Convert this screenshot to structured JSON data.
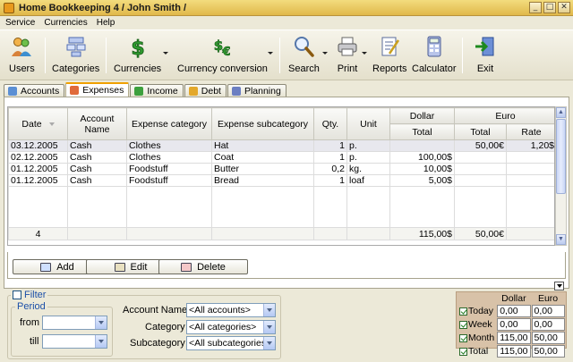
{
  "window": {
    "title": "Home Bookkeeping 4  / John Smith /",
    "controls": {
      "minimize": "_",
      "maximize": "□",
      "close": "✕"
    }
  },
  "menu": [
    "Service",
    "Currencies",
    "Help"
  ],
  "toolbar": {
    "users": "Users",
    "categories": "Categories",
    "currencies": "Currencies",
    "currency_conversion": "Currency conversion",
    "search": "Search",
    "print": "Print",
    "reports": "Reports",
    "calculator": "Calculator",
    "exit": "Exit"
  },
  "tabs": [
    {
      "label": "Accounts",
      "icon": "accounts-icon"
    },
    {
      "label": "Expenses",
      "icon": "expenses-icon",
      "active": true
    },
    {
      "label": "Income",
      "icon": "income-icon"
    },
    {
      "label": "Debt",
      "icon": "debt-icon"
    },
    {
      "label": "Planning",
      "icon": "planning-icon"
    }
  ],
  "grid": {
    "headers": {
      "date": "Date",
      "account": "Account Name",
      "category": "Expense category",
      "subcategory": "Expense subcategory",
      "qty": "Qty.",
      "unit": "Unit",
      "dollar": "Dollar",
      "dollar_total": "Total",
      "euro": "Euro",
      "euro_total": "Total",
      "euro_rate": "Rate"
    },
    "rows": [
      {
        "date": "03.12.2005",
        "account": "Cash",
        "category": "Clothes",
        "subcategory": "Hat",
        "qty": "1",
        "unit": "p.",
        "dollar_total": "",
        "euro_total": "50,00€",
        "euro_rate": "1,20$"
      },
      {
        "date": "02.12.2005",
        "account": "Cash",
        "category": "Clothes",
        "subcategory": "Coat",
        "qty": "1",
        "unit": "p.",
        "dollar_total": "100,00$",
        "euro_total": "",
        "euro_rate": ""
      },
      {
        "date": "01.12.2005",
        "account": "Cash",
        "category": "Foodstuff",
        "subcategory": "Butter",
        "qty": "0,2",
        "unit": "kg.",
        "dollar_total": "10,00$",
        "euro_total": "",
        "euro_rate": ""
      },
      {
        "date": "01.12.2005",
        "account": "Cash",
        "category": "Foodstuff",
        "subcategory": "Bread",
        "qty": "1",
        "unit": "loaf",
        "dollar_total": "5,00$",
        "euro_total": "",
        "euro_rate": ""
      }
    ],
    "footer": {
      "count": "4",
      "dollar_total": "115,00$",
      "euro_total": "50,00€"
    }
  },
  "actions": {
    "add": "Add",
    "edit": "Edit",
    "delete": "Delete"
  },
  "filter": {
    "label": "Filter",
    "period_label": "Period",
    "from_label": "from",
    "till_label": "till",
    "from_value": "",
    "till_value": "",
    "account_label": "Account Name",
    "account_value": "<All accounts>",
    "category_label": "Category",
    "category_value": "<All categories>",
    "subcategory_label": "Subcategory",
    "subcategory_value": "<All subcategories>"
  },
  "summary": {
    "col_dollar": "Dollar",
    "col_euro": "Euro",
    "rows": [
      {
        "label": "Today",
        "dollar": "0,00",
        "euro": "0,00"
      },
      {
        "label": "Week",
        "dollar": "0,00",
        "euro": "0,00"
      },
      {
        "label": "Month",
        "dollar": "115,00",
        "euro": "50,00"
      },
      {
        "label": "Total",
        "dollar": "115,00",
        "euro": "50,00"
      }
    ]
  },
  "colors": {
    "title_bar": "#e0b84a",
    "tab_accent": "#f0a000",
    "summary_bg": "#d8c2a8",
    "link_blue": "#1b4fa8"
  }
}
